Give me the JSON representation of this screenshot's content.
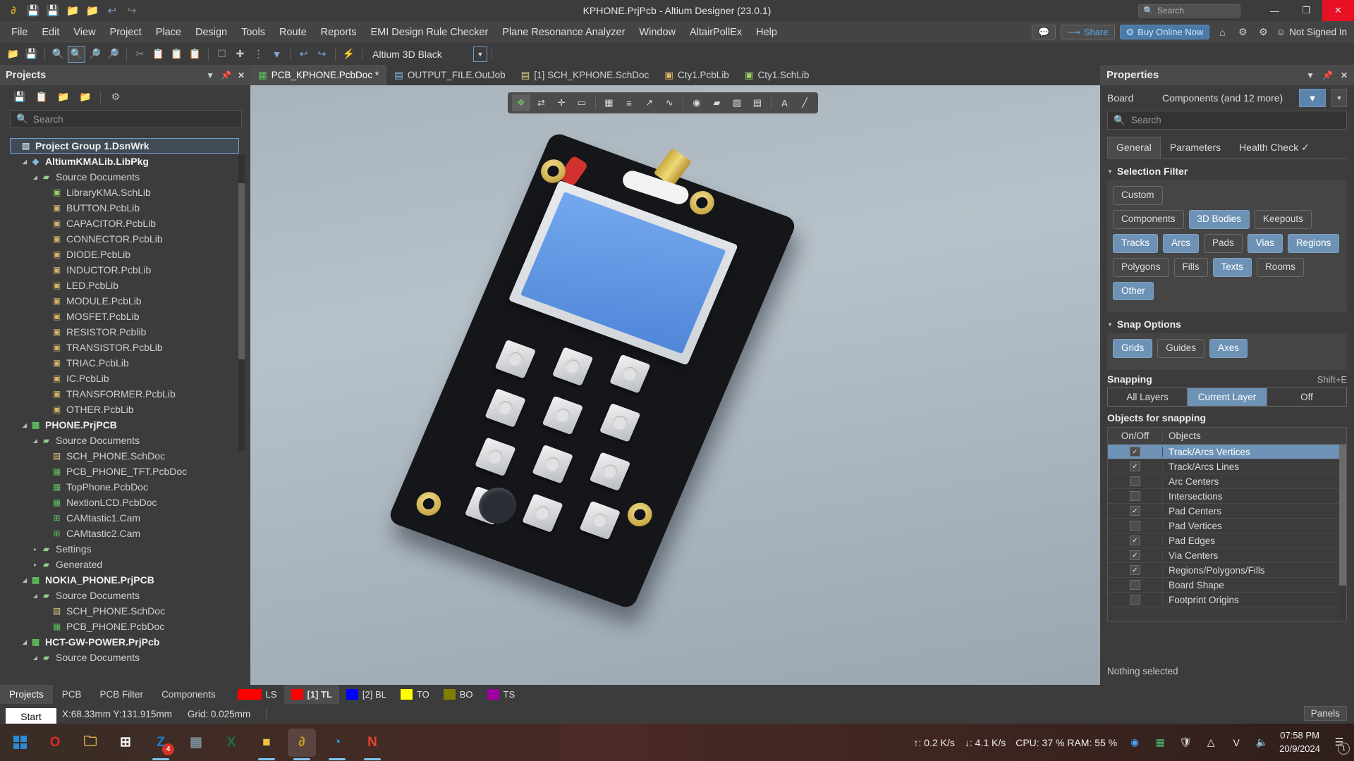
{
  "titlebar": {
    "title": "KPHONE.PrjPcb - Altium Designer (23.0.1)",
    "search_placeholder": "Search",
    "icons": [
      "altium-logo-icon",
      "save-icon",
      "save-all-icon",
      "open-folder-icon",
      "open-project-icon",
      "undo-icon",
      "redo-icon"
    ],
    "window_buttons": {
      "minimize": "—",
      "maximize": "❐",
      "close": "✕"
    }
  },
  "menubar": {
    "items": [
      "File",
      "Edit",
      "View",
      "Project",
      "Place",
      "Design",
      "Tools",
      "Route",
      "Reports",
      "EMI Design Rule Checker",
      "Plane Resonance Analyzer",
      "Window",
      "AltairPollEx",
      "Help"
    ],
    "comment_button": "comment-icon",
    "share_label": "Share",
    "buy_label": "Buy Online Now",
    "account_label": "Not Signed In"
  },
  "toolbar": {
    "layer_name": "Altium 3D Black",
    "tools": [
      "open-folder-icon",
      "save-icon",
      "print-preview-icon",
      "zoom-area-icon",
      "zoom-selected-icon",
      "clear-filter-icon",
      "cut-icon",
      "copy-icon",
      "paste-icon",
      "paste-special-icon",
      "select-rect-icon",
      "crosshair-icon",
      "measure-icon",
      "filter-off-icon",
      "undo-icon",
      "redo-icon",
      "cross-probe-icon"
    ]
  },
  "projects_panel": {
    "title": "Projects",
    "header_buttons": [
      "chevron-down-icon",
      "pin-icon",
      "close-icon"
    ],
    "toolbar_icons": [
      "save-icon",
      "copy-project-icon",
      "compile-icon",
      "project-options-icon",
      "gear-icon"
    ],
    "search_placeholder": "Search",
    "tree": [
      {
        "label": "Project Group 1.DsnWrk",
        "depth": 0,
        "bold": true,
        "selected": true,
        "arrow": "",
        "icon": "workspace-icon"
      },
      {
        "label": "AltiumKMALib.LibPkg",
        "depth": 1,
        "bold": true,
        "selected": false,
        "arrow": "◢",
        "icon": "libpkg-icon"
      },
      {
        "label": "Source Documents",
        "depth": 2,
        "bold": false,
        "selected": false,
        "arrow": "◢",
        "icon": "folder-icon"
      },
      {
        "label": "LibraryKMA.SchLib",
        "depth": 3,
        "bold": false,
        "selected": false,
        "arrow": "",
        "icon": "schlib-icon"
      },
      {
        "label": "BUTTON.PcbLib",
        "depth": 3,
        "bold": false,
        "selected": false,
        "arrow": "",
        "icon": "pcblib-icon"
      },
      {
        "label": "CAPACITOR.PcbLib",
        "depth": 3,
        "bold": false,
        "selected": false,
        "arrow": "",
        "icon": "pcblib-icon"
      },
      {
        "label": "CONNECTOR.PcbLib",
        "depth": 3,
        "bold": false,
        "selected": false,
        "arrow": "",
        "icon": "pcblib-icon"
      },
      {
        "label": "DIODE.PcbLib",
        "depth": 3,
        "bold": false,
        "selected": false,
        "arrow": "",
        "icon": "pcblib-icon"
      },
      {
        "label": "INDUCTOR.PcbLib",
        "depth": 3,
        "bold": false,
        "selected": false,
        "arrow": "",
        "icon": "pcblib-icon"
      },
      {
        "label": "LED.PcbLib",
        "depth": 3,
        "bold": false,
        "selected": false,
        "arrow": "",
        "icon": "pcblib-icon"
      },
      {
        "label": "MODULE.PcbLib",
        "depth": 3,
        "bold": false,
        "selected": false,
        "arrow": "",
        "icon": "pcblib-icon"
      },
      {
        "label": "MOSFET.PcbLib",
        "depth": 3,
        "bold": false,
        "selected": false,
        "arrow": "",
        "icon": "pcblib-icon"
      },
      {
        "label": "RESISTOR.Pcblib",
        "depth": 3,
        "bold": false,
        "selected": false,
        "arrow": "",
        "icon": "pcblib-icon"
      },
      {
        "label": "TRANSISTOR.PcbLib",
        "depth": 3,
        "bold": false,
        "selected": false,
        "arrow": "",
        "icon": "pcblib-icon"
      },
      {
        "label": "TRIAC.PcbLib",
        "depth": 3,
        "bold": false,
        "selected": false,
        "arrow": "",
        "icon": "pcblib-icon"
      },
      {
        "label": "IC.PcbLib",
        "depth": 3,
        "bold": false,
        "selected": false,
        "arrow": "",
        "icon": "pcblib-icon"
      },
      {
        "label": "TRANSFORMER.PcbLib",
        "depth": 3,
        "bold": false,
        "selected": false,
        "arrow": "",
        "icon": "pcblib-icon"
      },
      {
        "label": "OTHER.PcbLib",
        "depth": 3,
        "bold": false,
        "selected": false,
        "arrow": "",
        "icon": "pcblib-icon"
      },
      {
        "label": "PHONE.PrjPCB",
        "depth": 1,
        "bold": true,
        "selected": false,
        "arrow": "◢",
        "icon": "prjpcb-icon"
      },
      {
        "label": "Source Documents",
        "depth": 2,
        "bold": false,
        "selected": false,
        "arrow": "◢",
        "icon": "folder-icon"
      },
      {
        "label": "SCH_PHONE.SchDoc",
        "depth": 3,
        "bold": false,
        "selected": false,
        "arrow": "",
        "icon": "schdoc-icon"
      },
      {
        "label": "PCB_PHONE_TFT.PcbDoc",
        "depth": 3,
        "bold": false,
        "selected": false,
        "arrow": "",
        "icon": "pcbdoc-icon"
      },
      {
        "label": "TopPhone.PcbDoc",
        "depth": 3,
        "bold": false,
        "selected": false,
        "arrow": "",
        "icon": "pcbdoc-icon"
      },
      {
        "label": "NextionLCD.PcbDoc",
        "depth": 3,
        "bold": false,
        "selected": false,
        "arrow": "",
        "icon": "pcbdoc-icon"
      },
      {
        "label": "CAMtastic1.Cam",
        "depth": 3,
        "bold": false,
        "selected": false,
        "arrow": "",
        "icon": "cam-icon"
      },
      {
        "label": "CAMtastic2.Cam",
        "depth": 3,
        "bold": false,
        "selected": false,
        "arrow": "",
        "icon": "cam-icon"
      },
      {
        "label": "Settings",
        "depth": 2,
        "bold": false,
        "selected": false,
        "arrow": "▸",
        "icon": "folder-icon"
      },
      {
        "label": "Generated",
        "depth": 2,
        "bold": false,
        "selected": false,
        "arrow": "▸",
        "icon": "folder-icon"
      },
      {
        "label": "NOKIA_PHONE.PrjPCB",
        "depth": 1,
        "bold": true,
        "selected": false,
        "arrow": "◢",
        "icon": "prjpcb-icon"
      },
      {
        "label": "Source Documents",
        "depth": 2,
        "bold": false,
        "selected": false,
        "arrow": "◢",
        "icon": "folder-icon"
      },
      {
        "label": "SCH_PHONE.SchDoc",
        "depth": 3,
        "bold": false,
        "selected": false,
        "arrow": "",
        "icon": "schdoc-icon"
      },
      {
        "label": "PCB_PHONE.PcbDoc",
        "depth": 3,
        "bold": false,
        "selected": false,
        "arrow": "",
        "icon": "pcbdoc-icon"
      },
      {
        "label": "HCT-GW-POWER.PrjPcb",
        "depth": 1,
        "bold": true,
        "selected": false,
        "arrow": "◢",
        "icon": "prjpcb-icon"
      },
      {
        "label": "Source Documents",
        "depth": 2,
        "bold": false,
        "selected": false,
        "arrow": "◢",
        "icon": "folder-icon"
      }
    ]
  },
  "document_tabs": [
    {
      "label": "PCB_KPHONE.PcbDoc *",
      "icon": "pcbdoc-icon",
      "active": true
    },
    {
      "label": "OUTPUT_FILE.OutJob",
      "icon": "outjob-icon",
      "active": false
    },
    {
      "label": "[1] SCH_KPHONE.SchDoc",
      "icon": "schdoc-icon",
      "active": false
    },
    {
      "label": "Cty1.PcbLib",
      "icon": "pcblib-icon",
      "active": false
    },
    {
      "label": "Cty1.SchLib",
      "icon": "schlib-icon",
      "active": false
    }
  ],
  "view_toolbar": {
    "tools": [
      "select-touched-icon",
      "cross-select-icon",
      "move-icon",
      "rectangle-icon",
      "chart-icon",
      "layers-icon",
      "route-icon",
      "length-tune-icon",
      "via-icon",
      "polygon-icon",
      "clearance-icon",
      "report-icon",
      "text-icon",
      "line-icon"
    ]
  },
  "properties_panel": {
    "title": "Properties",
    "header_buttons": [
      "chevron-down-icon",
      "pin-icon",
      "close-icon"
    ],
    "object_label": "Board",
    "object_value": "Components (and 12 more)",
    "search_placeholder": "Search",
    "tabs": [
      {
        "label": "General",
        "active": true
      },
      {
        "label": "Parameters",
        "active": false
      },
      {
        "label": "Health Check ✓",
        "active": false
      }
    ],
    "selection_filter": {
      "title": "Selection Filter",
      "rows": [
        [
          {
            "label": "Custom",
            "on": false
          }
        ],
        [
          {
            "label": "Components",
            "on": false
          },
          {
            "label": "3D Bodies",
            "on": true
          },
          {
            "label": "Keepouts",
            "on": false
          }
        ],
        [
          {
            "label": "Tracks",
            "on": true
          },
          {
            "label": "Arcs",
            "on": true
          },
          {
            "label": "Pads",
            "on": false
          },
          {
            "label": "Vias",
            "on": true
          },
          {
            "label": "Regions",
            "on": true
          }
        ],
        [
          {
            "label": "Polygons",
            "on": false
          },
          {
            "label": "Fills",
            "on": false
          },
          {
            "label": "Texts",
            "on": true
          },
          {
            "label": "Rooms",
            "on": false
          }
        ],
        [
          {
            "label": "Other",
            "on": true
          }
        ]
      ]
    },
    "snap_options": {
      "title": "Snap Options",
      "toggles": [
        {
          "label": "Grids",
          "on": true
        },
        {
          "label": "Guides",
          "on": false
        },
        {
          "label": "Axes",
          "on": true
        }
      ],
      "snapping_label": "Snapping",
      "snapping_shortcut": "Shift+E",
      "snapping_modes": [
        {
          "label": "All Layers",
          "on": false
        },
        {
          "label": "Current Layer",
          "on": true
        },
        {
          "label": "Off",
          "on": false
        }
      ],
      "objects_label": "Objects for snapping",
      "grid_headers": {
        "on_off": "On/Off",
        "objects": "Objects"
      },
      "grid_rows": [
        {
          "label": "Track/Arcs Vertices",
          "checked": true,
          "selected": true
        },
        {
          "label": "Track/Arcs Lines",
          "checked": true,
          "selected": false
        },
        {
          "label": "Arc Centers",
          "checked": false,
          "selected": false
        },
        {
          "label": "Intersections",
          "checked": false,
          "selected": false
        },
        {
          "label": "Pad Centers",
          "checked": true,
          "selected": false
        },
        {
          "label": "Pad Vertices",
          "checked": false,
          "selected": false
        },
        {
          "label": "Pad Edges",
          "checked": true,
          "selected": false
        },
        {
          "label": "Via Centers",
          "checked": true,
          "selected": false
        },
        {
          "label": "Regions/Polygons/Fills",
          "checked": true,
          "selected": false
        },
        {
          "label": "Board Shape",
          "checked": false,
          "selected": false
        },
        {
          "label": "Footprint Origins",
          "checked": false,
          "selected": false
        }
      ]
    },
    "status": "Nothing selected"
  },
  "bottom_bar": {
    "tabs": [
      {
        "label": "Projects",
        "active": true
      },
      {
        "label": "PCB",
        "active": false
      },
      {
        "label": "PCB Filter",
        "active": false
      },
      {
        "label": "Components",
        "active": false
      }
    ],
    "layers": [
      {
        "label": "LS",
        "color": "#ff0000",
        "wide": true,
        "active": false
      },
      {
        "label": "[1] TL",
        "color": "#ff0000",
        "wide": false,
        "active": true
      },
      {
        "label": "[2] BL",
        "color": "#0000ff",
        "wide": false,
        "active": false
      },
      {
        "label": "TO",
        "color": "#ffff00",
        "wide": false,
        "active": false
      },
      {
        "label": "BO",
        "color": "#808000",
        "wide": false,
        "active": false
      },
      {
        "label": "TS",
        "color": "#a000a0",
        "wide": false,
        "active": false
      }
    ],
    "status_coords": "X:68.33mm Y:131.915mm",
    "status_grid": "Grid: 0.025mm",
    "panels_button": "Panels",
    "start_button": "Start"
  },
  "taskbar": {
    "apps": [
      {
        "name": "start-icon",
        "glyph": "⊞",
        "active": false,
        "badge": "",
        "running": false
      },
      {
        "name": "opera-icon",
        "glyph": "O",
        "active": false,
        "badge": "",
        "running": false
      },
      {
        "name": "file-explorer-icon",
        "glyph": "🗀",
        "active": false,
        "badge": "",
        "running": false
      },
      {
        "name": "microsoft-store-icon",
        "glyph": "⊞",
        "active": false,
        "badge": "",
        "running": false
      },
      {
        "name": "zalo-icon",
        "glyph": "Z",
        "active": false,
        "badge": "4",
        "running": true
      },
      {
        "name": "calculator-icon",
        "glyph": "▦",
        "active": false,
        "badge": "",
        "running": false
      },
      {
        "name": "excel-icon",
        "glyph": "X",
        "active": false,
        "badge": "",
        "running": false
      },
      {
        "name": "sticky-notes-icon",
        "glyph": "■",
        "active": false,
        "badge": "",
        "running": true
      },
      {
        "name": "altium-designer-icon",
        "glyph": "∂",
        "active": true,
        "badge": "",
        "running": true
      },
      {
        "name": "edge-icon",
        "glyph": "◔",
        "active": false,
        "badge": "",
        "running": true
      },
      {
        "name": "nox-icon",
        "glyph": "N",
        "active": false,
        "badge": "",
        "running": true
      }
    ],
    "upload_speed": "↑: 0.2 K/s",
    "download_speed": "↓: 4.1 K/s",
    "cpu_ram": "CPU: 37 % RAM: 55 %",
    "tray": [
      "zalo-tray-icon",
      "apps-tray-icon",
      "security-tray-icon",
      "wifi-tray-icon",
      "vpn-tray-icon",
      "volume-tray-icon"
    ],
    "time": "07:58 PM",
    "date": "20/9/2024",
    "notification_count": "1"
  },
  "colors": {
    "accent": "#6d92b5",
    "panel_bg": "#3c3c3c",
    "header_bg": "#4a4a4a",
    "buy_button": "#4a7aa8",
    "close_button": "#e81123"
  }
}
